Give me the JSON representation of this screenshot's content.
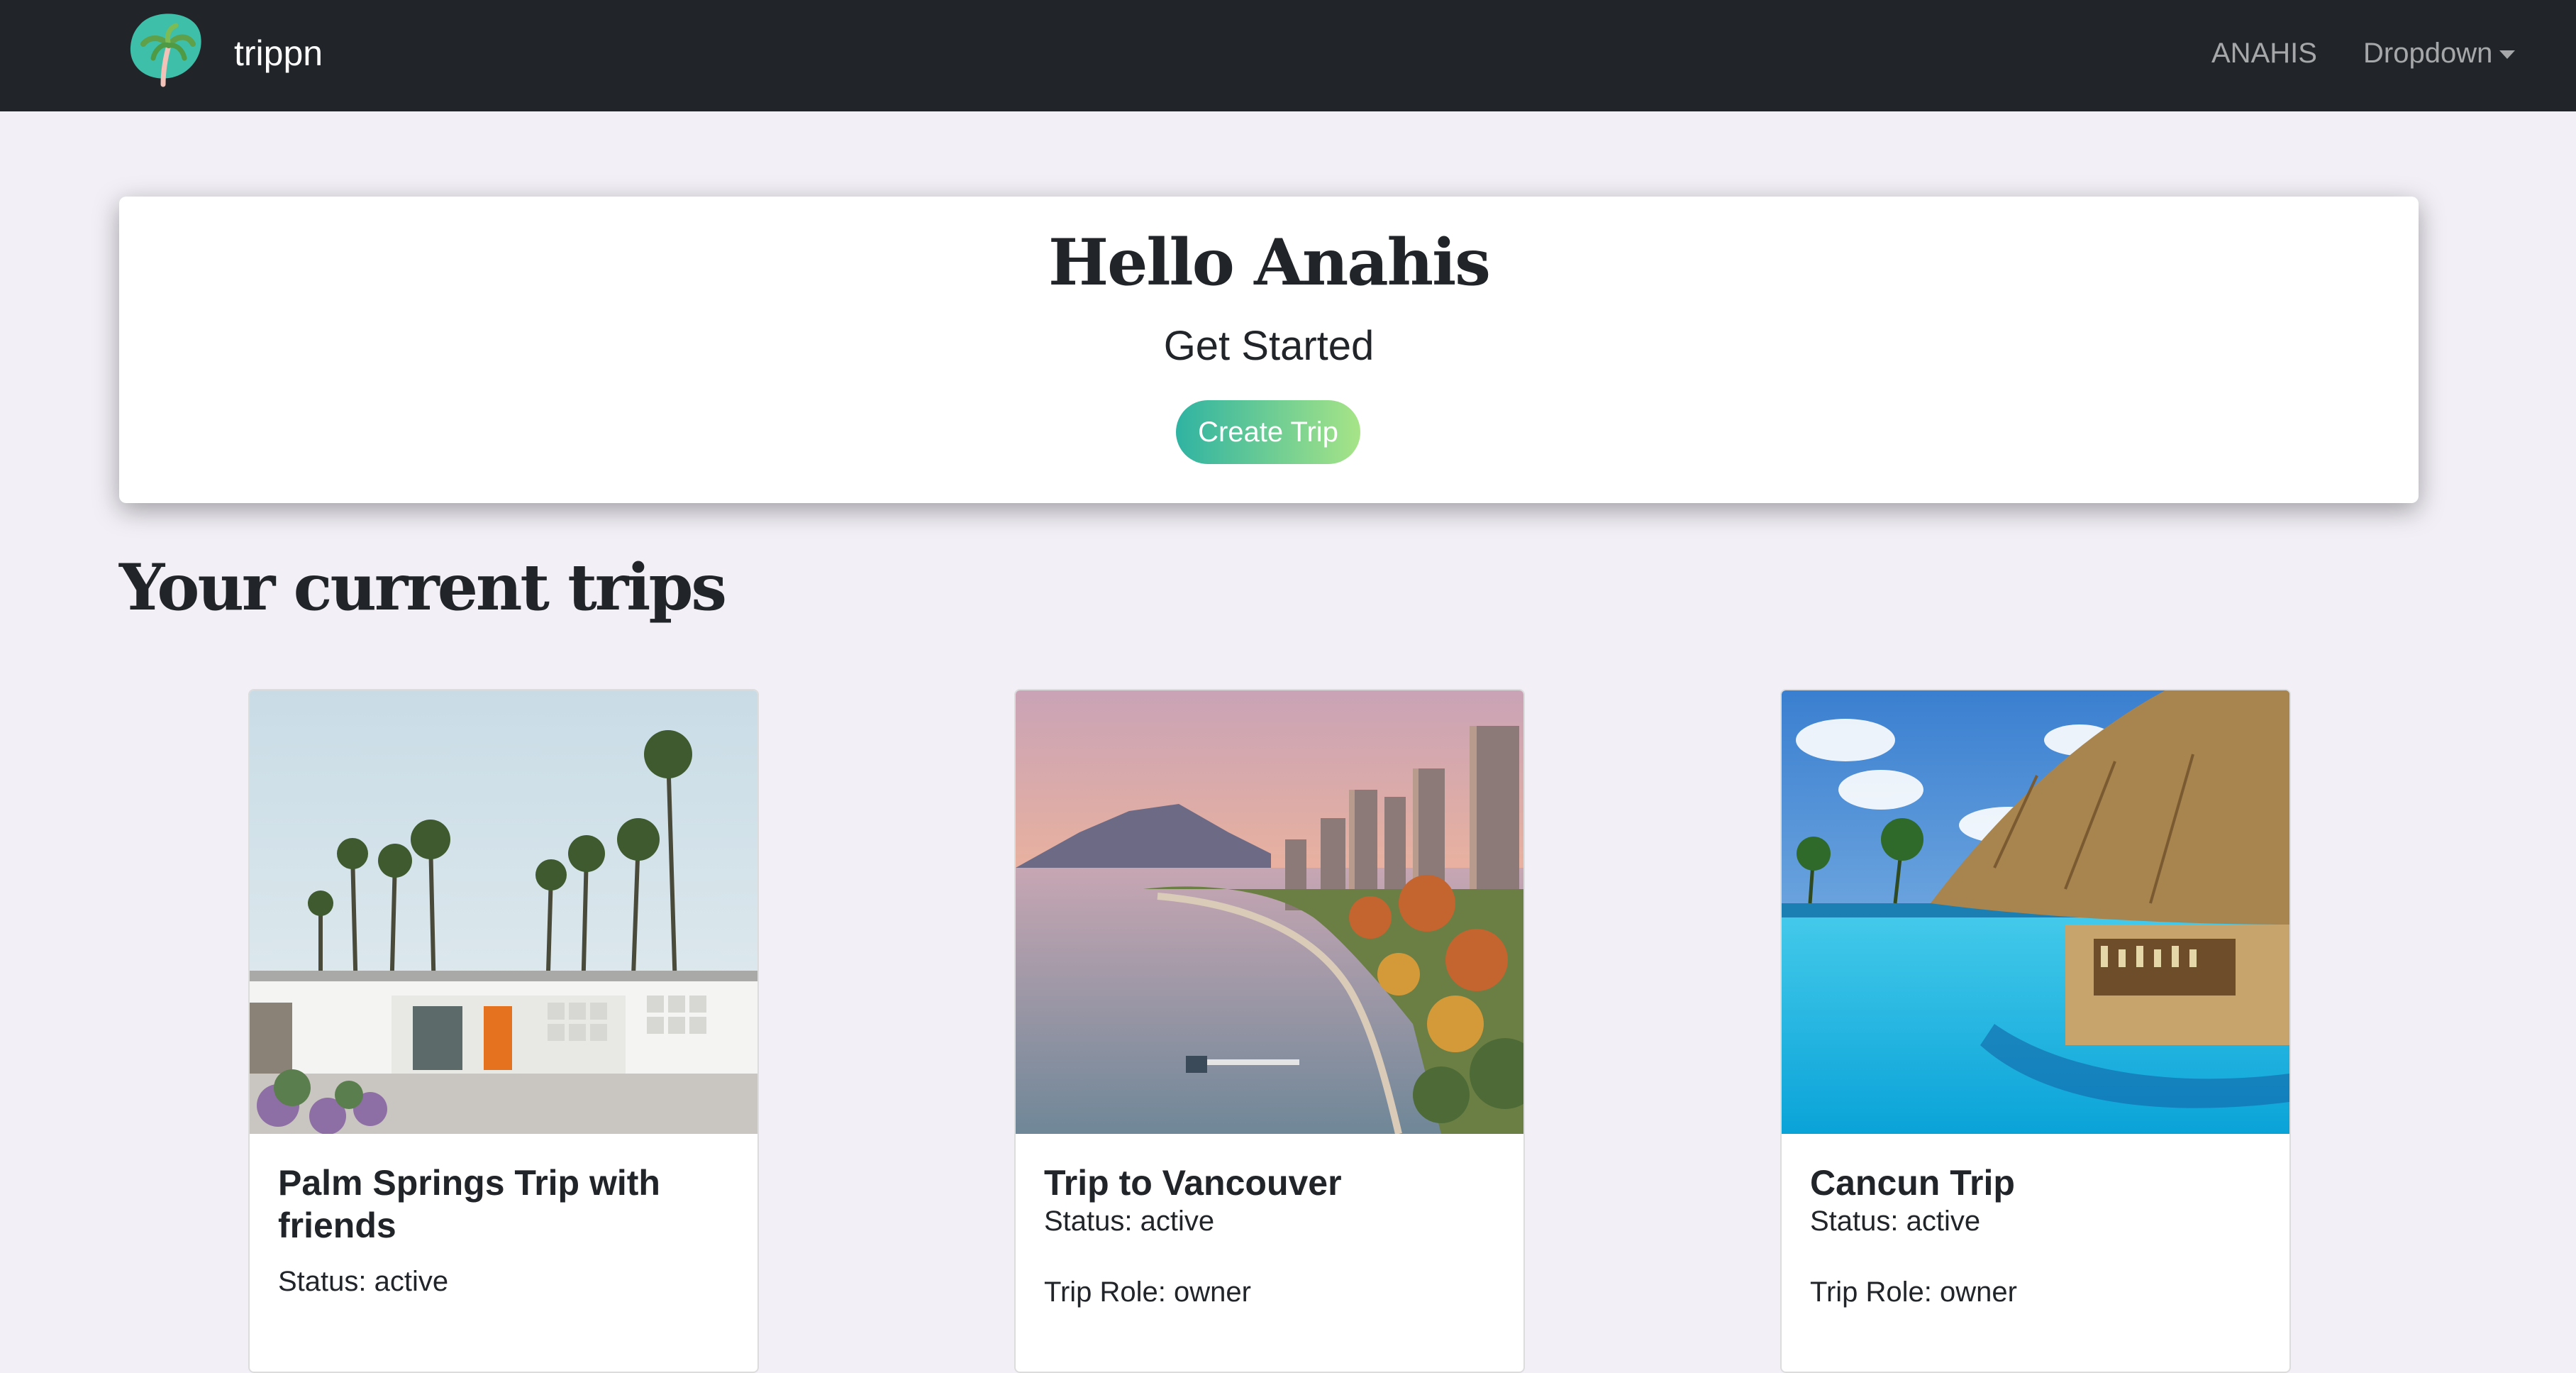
{
  "navbar": {
    "brand": "trippn",
    "logo_icon": "palm-tree-logo-icon",
    "user_label": "ANAHIS",
    "dropdown_label": "Dropdown",
    "background": "#212529"
  },
  "hero": {
    "greeting": "Hello Anahis",
    "subtitle": "Get Started",
    "create_button_label": "Create Trip",
    "button_gradient": [
      "#2fb3a2",
      "#a7e487"
    ]
  },
  "trips_section": {
    "title": "Your current trips",
    "trips": [
      {
        "title": "Palm Springs Trip with friends",
        "status": "Status: active",
        "role": "",
        "image": "palm-springs-house-photo"
      },
      {
        "title": "Trip to Vancouver",
        "status": "Status: active",
        "role": "Trip Role: owner",
        "image": "vancouver-skyline-photo"
      },
      {
        "title": "Cancun Trip",
        "status": "Status: active",
        "role": "Trip Role: owner",
        "image": "cancun-pool-bar-photo"
      }
    ]
  },
  "colors": {
    "page_background": "#f2f0f6",
    "text": "#212529"
  }
}
